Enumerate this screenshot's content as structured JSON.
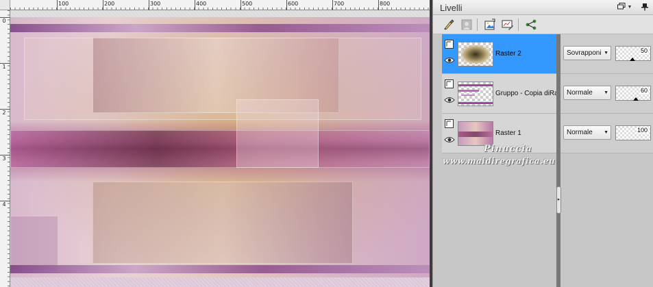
{
  "ruler": {
    "top_labels": [
      "100",
      "200",
      "300",
      "400",
      "500",
      "600",
      "700",
      "800"
    ],
    "left_labels": [
      "0",
      "1",
      "2",
      "3",
      "4"
    ]
  },
  "panel": {
    "title": "Livelli"
  },
  "toolbar": {
    "icons": [
      "brush-icon",
      "mask-icon",
      "new-layer-icon",
      "adjustment-layer-icon",
      "share-icon"
    ]
  },
  "layers": [
    {
      "name": "Raster 2",
      "blend_mode": "Sovrapponi",
      "opacity": "50",
      "opacity_level": 0.5,
      "selected": true
    },
    {
      "name": "Gruppo - Copia diRast",
      "blend_mode": "Normale",
      "opacity": "60",
      "opacity_level": 0.6,
      "selected": false
    },
    {
      "name": "Raster 1",
      "blend_mode": "Normale",
      "opacity": "100",
      "opacity_level": 1.0,
      "selected": false
    }
  ],
  "watermark": {
    "line1": "Pinuccia",
    "line2": "www.maidiregrafica.eu"
  },
  "colors": {
    "selection": "#3399ff",
    "panel_bg": "#d4d4d4"
  }
}
